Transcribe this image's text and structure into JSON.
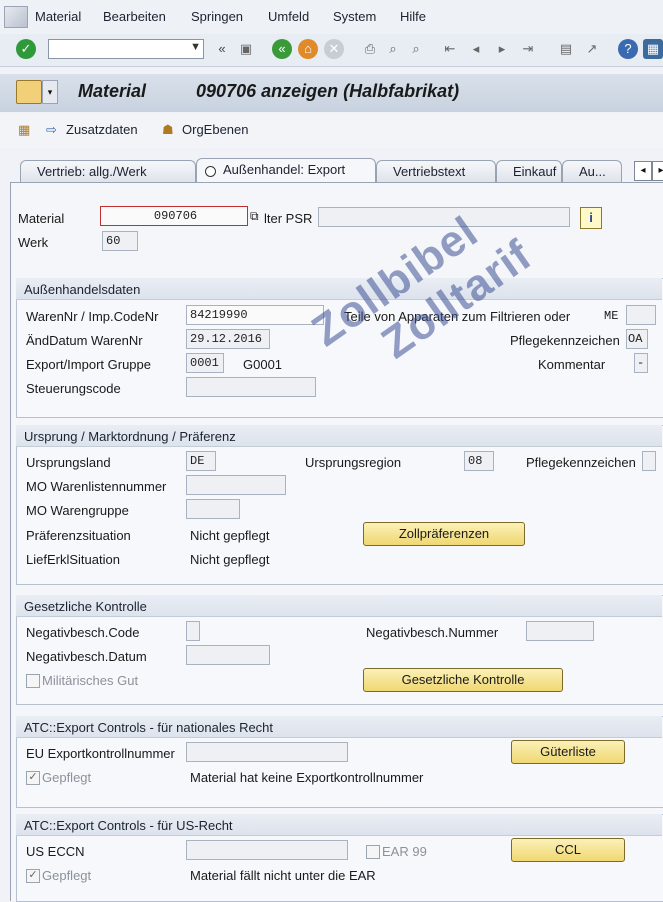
{
  "menu": [
    "Material",
    "Bearbeiten",
    "Springen",
    "Umfeld",
    "System",
    "Hilfe"
  ],
  "title": "Material          090706 anzeigen (Halbfabrikat)",
  "app_toolbar": {
    "zusatzdaten": "Zusatzdaten",
    "orgebenen": "OrgEbenen"
  },
  "tabs": [
    "Vertrieb: allg./Werk",
    "Außenhandel: Export",
    "Vertriebstext",
    "Einkauf",
    "Au..."
  ],
  "header": {
    "material_label": "Material",
    "material_value": "090706",
    "psr_label": "lter PSR",
    "werk_label": "Werk",
    "werk_value": "60"
  },
  "aussenhandel": {
    "title": "Außenhandelsdaten",
    "warennr_label": "WarenNr / Imp.CodeNr",
    "warennr_value": "84219990",
    "teile_label": "Teile von Apparaten zum Filtrieren oder",
    "me_value": "ME",
    "aenddatum_label": "ÄndDatum  WarenNr",
    "aenddatum_value": "29.12.2016",
    "pflege_label": "Pflegekennzeichen",
    "pflege_value": "OA",
    "gruppe_label": "Export/Import Gruppe",
    "gruppe_value": "0001",
    "gruppe_text": "G0001",
    "kommentar_label": "Kommentar",
    "kommentar_value": "-",
    "steuer_label": "Steuerungscode"
  },
  "ursprung": {
    "title": "Ursprung / Marktordnung / Präferenz",
    "land_label": "Ursprungsland",
    "land_value": "DE",
    "region_label": "Ursprungsregion",
    "region_value": "08",
    "pflege_label": "Pflegekennzeichen",
    "mo_liste_label": "MO Warenlistennummer",
    "mo_gruppe_label": "MO Warengruppe",
    "praef_label": "Präferenzsituation",
    "praef_value": "Nicht gepflegt",
    "lief_label": "LiefErklSituation",
    "lief_value": "Nicht gepflegt",
    "zoll_button": "Zollpräferenzen"
  },
  "gesetzlich": {
    "title": "Gesetzliche Kontrolle",
    "code_label": "Negativbesch.Code",
    "nummer_label": "Negativbesch.Nummer",
    "datum_label": "Negativbesch.Datum",
    "militaer_label": "Militärisches Gut",
    "button": "Gesetzliche Kontrolle"
  },
  "atc_nat": {
    "title": "ATC::Export Controls - für nationales Recht",
    "eu_label": "EU Exportkontrollnummer",
    "gepflegt_label": "Gepflegt",
    "info": "Material hat keine Exportkontrollnummer",
    "button": "Güterliste"
  },
  "atc_us": {
    "title": "ATC::Export Controls - für US-Recht",
    "eccn_label": "US ECCN",
    "ear_label": "EAR 99",
    "gepflegt_label": "Gepflegt",
    "info": "Material fällt nicht unter die EAR",
    "button": "CCL"
  },
  "watermark": [
    "Zollbibel",
    "Zolltarif"
  ]
}
